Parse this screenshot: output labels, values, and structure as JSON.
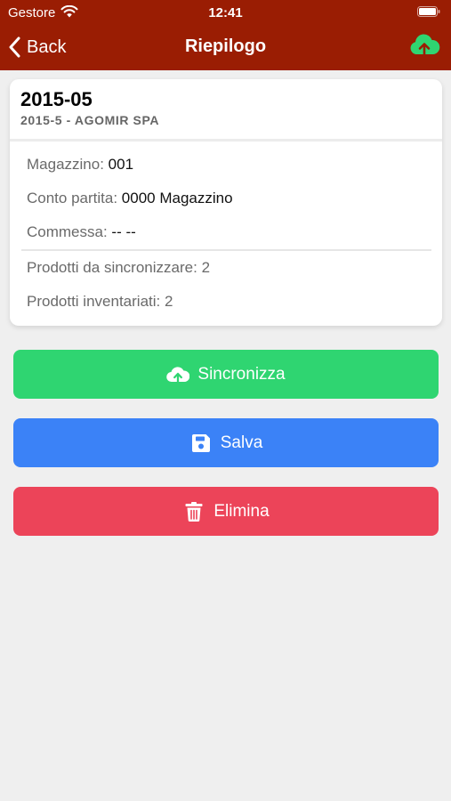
{
  "status_bar": {
    "carrier": "Gestore",
    "time": "12:41"
  },
  "nav": {
    "back_label": "Back",
    "title": "Riepilogo"
  },
  "card": {
    "code": "2015-05",
    "subtitle": "2015-5 - AGOMIR SPA",
    "magazzino_label": "Magazzino:",
    "magazzino_value": "001",
    "conto_label": "Conto partita:",
    "conto_value": "0000 Magazzino",
    "commessa_label": "Commessa:",
    "commessa_value": "-- --",
    "prodotti_sync_label": "Prodotti da sincronizzare:",
    "prodotti_sync_value": "2",
    "prodotti_inv_label": "Prodotti inventariati:",
    "prodotti_inv_value": "2"
  },
  "actions": {
    "sync_label": "Sincronizza",
    "save_label": "Salva",
    "delete_label": "Elimina"
  },
  "colors": {
    "header_bg": "#9a1d03",
    "upload_icon": "#2fd571",
    "sync_button": "#2fd571",
    "save_button": "#3b82f7",
    "delete_button": "#ec4459",
    "page_bg": "#efefef"
  },
  "icons": {
    "upload": "cloud-upload-icon",
    "sync": "cloud-upload-icon",
    "save": "floppy-disk-icon",
    "delete": "trash-icon",
    "back": "chevron-left-icon"
  }
}
